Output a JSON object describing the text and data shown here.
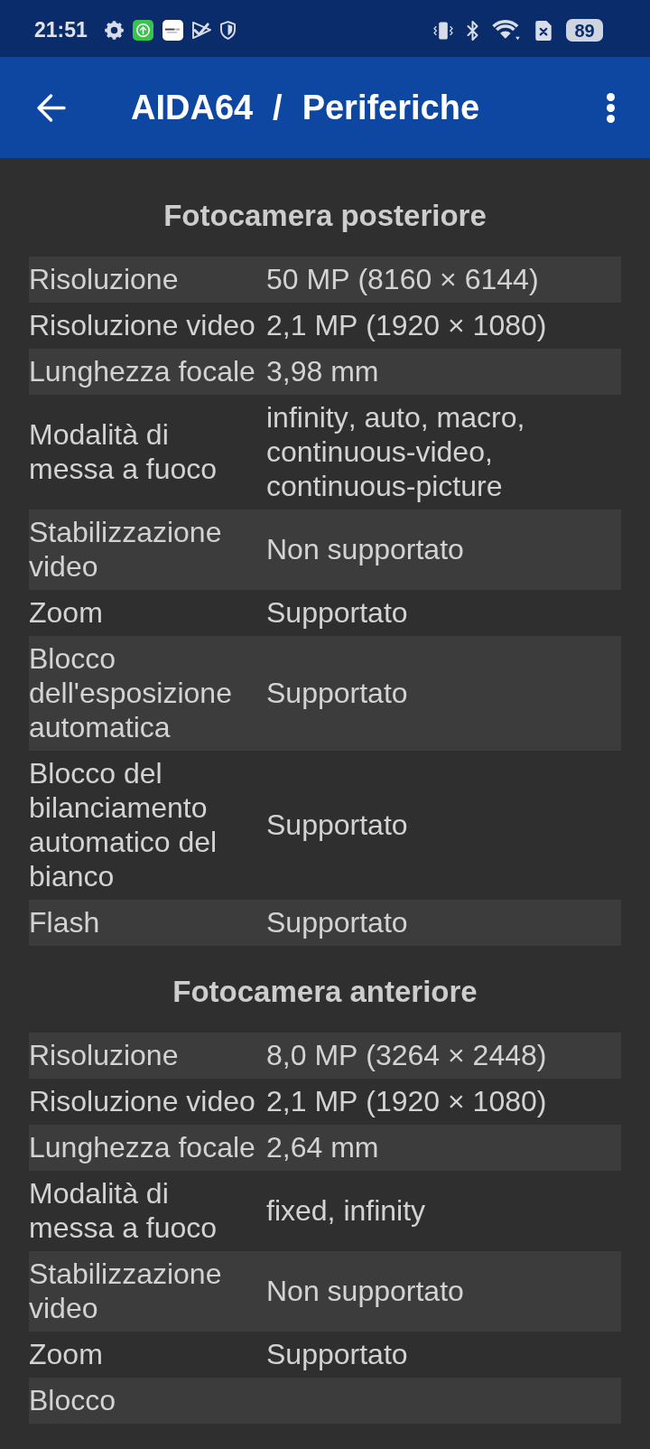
{
  "status_bar": {
    "time": "21:51",
    "battery": "89"
  },
  "app_bar": {
    "title": "AIDA64 / Periferiche"
  },
  "sections": [
    {
      "title": "Fotocamera posteriore",
      "rows": [
        {
          "label": "Risoluzione",
          "value": "50 MP (8160 × 6144)"
        },
        {
          "label": "Risoluzione video",
          "value": "2,1 MP (1920 × 1080)"
        },
        {
          "label": "Lunghezza focale",
          "value": "3,98 mm"
        },
        {
          "label": "Modalità di messa a fuoco",
          "value": "infinity, auto, macro, continuous-video, continuous-picture"
        },
        {
          "label": "Stabilizzazione video",
          "value": "Non supportato"
        },
        {
          "label": "Zoom",
          "value": "Supportato"
        },
        {
          "label": "Blocco dell'esposizione automatica",
          "value": "Supportato"
        },
        {
          "label": "Blocco del bilanciamento automatico del bianco",
          "value": "Supportato"
        },
        {
          "label": "Flash",
          "value": "Supportato"
        }
      ]
    },
    {
      "title": "Fotocamera anteriore",
      "rows": [
        {
          "label": "Risoluzione",
          "value": "8,0 MP (3264 × 2448)"
        },
        {
          "label": "Risoluzione video",
          "value": "2,1 MP (1920 × 1080)"
        },
        {
          "label": "Lunghezza focale",
          "value": "2,64 mm"
        },
        {
          "label": "Modalità di messa a fuoco",
          "value": "fixed, infinity"
        },
        {
          "label": "Stabilizzazione video",
          "value": "Non supportato"
        },
        {
          "label": "Zoom",
          "value": "Supportato"
        },
        {
          "label": "Blocco"
        }
      ]
    }
  ]
}
